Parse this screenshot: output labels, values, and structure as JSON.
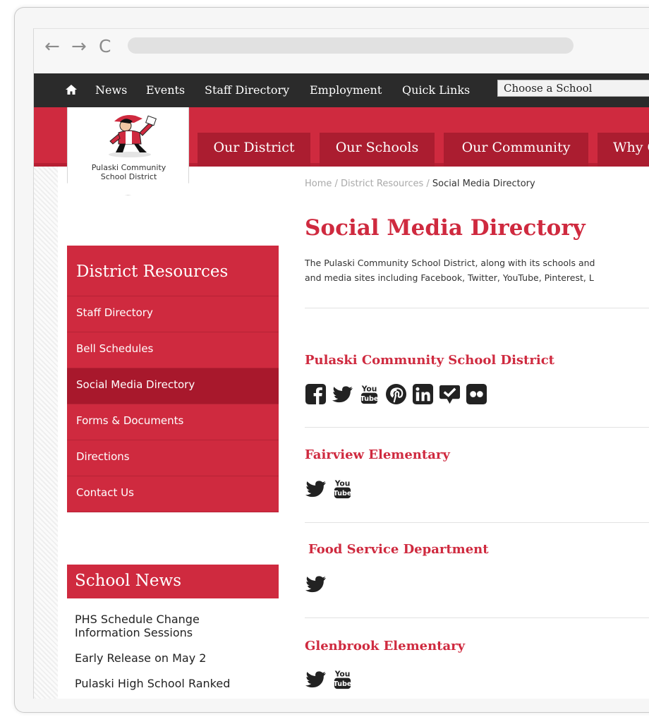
{
  "browser": {
    "back_glyph": "←",
    "forward_glyph": "→",
    "reload_glyph": "C"
  },
  "top_nav": {
    "home_icon": "home-icon",
    "links": [
      "News",
      "Events",
      "Staff Directory",
      "Employment",
      "Quick Links"
    ],
    "school_select": "Choose a School"
  },
  "logo": {
    "line1": "Pulaski Community",
    "line2": "School District"
  },
  "main_tabs": [
    "Our District",
    "Our Schools",
    "Our Community",
    "Why C"
  ],
  "breadcrumb": {
    "home": "Home",
    "sep": " / ",
    "section": "District Resources",
    "current": "Social Media Directory"
  },
  "page": {
    "title": "Social Media Directory",
    "intro_line1": "The Pulaski Community School District, along with its schools and",
    "intro_line2": "and media sites including Facebook, Twitter, YouTube, Pinterest, L"
  },
  "sidebar": {
    "title": "District Resources",
    "items": [
      "Staff Directory",
      "Bell Schedules",
      "Social Media Directory",
      "Forms & Documents",
      "Directions",
      "Contact Us"
    ],
    "active_index": 2
  },
  "news": {
    "title": "School News",
    "items": [
      "PHS Schedule Change",
      "Information Sessions",
      "Early Release on May 2",
      "Pulaski High School Ranked"
    ]
  },
  "sections": [
    {
      "name": "Pulaski Community School District",
      "icons": [
        "facebook-icon",
        "twitter-icon",
        "youtube-icon",
        "pinterest-icon",
        "linkedin-icon",
        "foursquare-icon",
        "flickr-icon"
      ]
    },
    {
      "name": "Fairview Elementary",
      "icons": [
        "twitter-icon",
        "youtube-icon"
      ]
    },
    {
      "name": "Food Service Department",
      "icons": [
        "twitter-icon"
      ]
    },
    {
      "name": "Glenbrook Elementary",
      "icons": [
        "twitter-icon",
        "youtube-icon"
      ]
    }
  ],
  "colors": {
    "brand_red": "#cf2a3f",
    "dark_red": "#ab1d30",
    "topnav": "#2b2b2b",
    "icon": "#222222"
  }
}
